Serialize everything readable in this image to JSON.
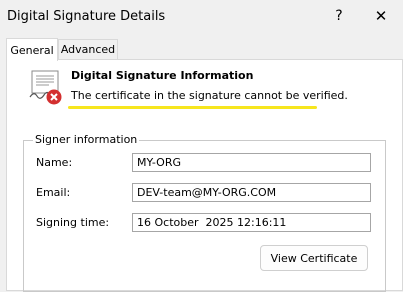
{
  "window": {
    "title": "Digital Signature Details",
    "help_glyph": "?",
    "close_glyph": "✕"
  },
  "tabs": [
    {
      "label": "General",
      "active": true
    },
    {
      "label": "Advanced",
      "active": false
    }
  ],
  "info": {
    "icon": "certificate-error-icon",
    "title": "Digital Signature Information",
    "message": "The certificate in the signature cannot be verified."
  },
  "signer": {
    "group_label": "Signer information",
    "name_label": "Name:",
    "name_value": "MY-ORG",
    "email_label": "Email:",
    "email_value": "DEV-team@MY-ORG.COM",
    "time_label": "Signing time:",
    "time_value": "16 October  2025 12:16:11"
  },
  "buttons": {
    "view_certificate": "View Certificate"
  },
  "colors": {
    "highlight": "#f7e61e",
    "error": "#d32f2f"
  }
}
